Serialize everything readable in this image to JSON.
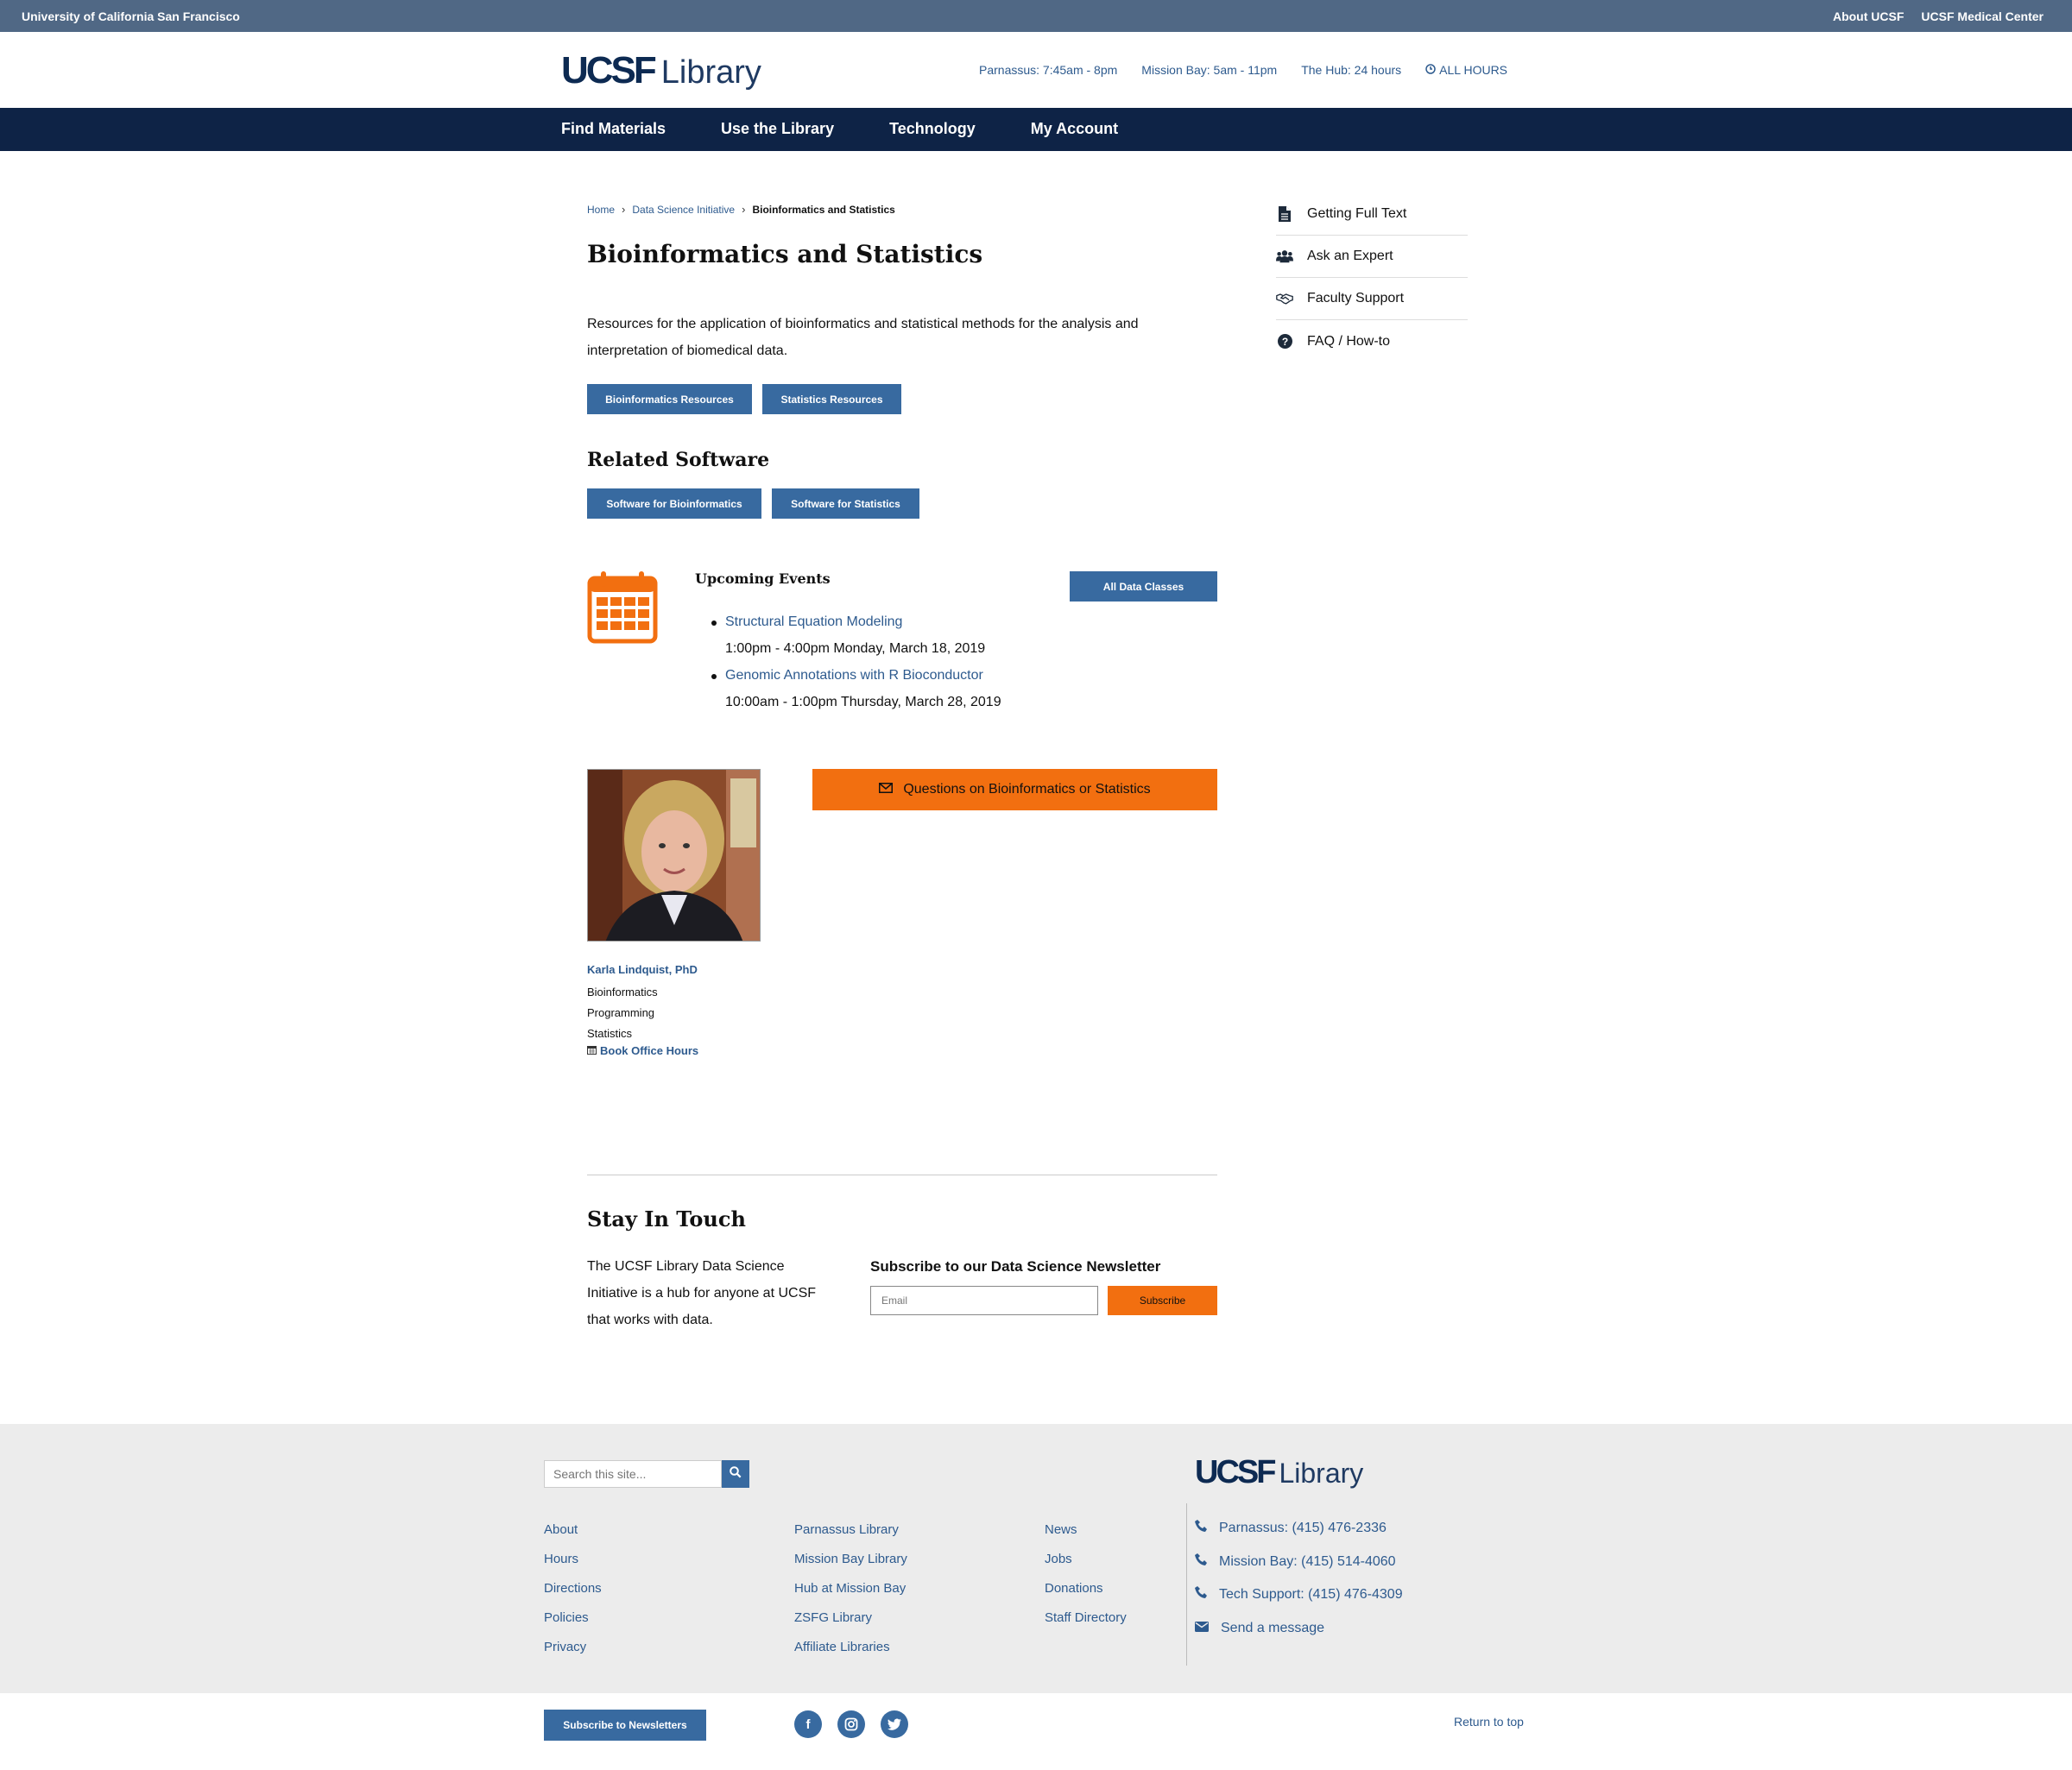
{
  "util": {
    "left": "University of California San Francisco",
    "right": [
      "About UCSF",
      "UCSF Medical Center"
    ]
  },
  "header": {
    "logo_mark": "UCSF",
    "logo_text": "Library",
    "hours": [
      "Parnassus: 7:45am - 8pm",
      "Mission Bay: 5am - 11pm",
      "The Hub: 24 hours"
    ],
    "all_hours": "ALL HOURS"
  },
  "nav": [
    "Find Materials",
    "Use the Library",
    "Technology",
    "My Account"
  ],
  "breadcrumb": {
    "home": "Home",
    "parent": "Data Science Initiative",
    "current": "Bioinformatics and Statistics"
  },
  "main": {
    "title": "Bioinformatics and Statistics",
    "intro": "Resources for the application of bioinformatics and statistical methods for the analysis and interpretation of biomedical data.",
    "buttons": [
      "Bioinformatics Resources",
      "Statistics Resources"
    ],
    "related_title": "Related Software",
    "software_buttons": [
      "Software for Bioinformatics",
      "Software for Statistics"
    ]
  },
  "events": {
    "title": "Upcoming Events",
    "all_button": "All Data Classes",
    "items": [
      {
        "name": "Structural Equation Modeling",
        "when": "1:00pm - 4:00pm Monday, March 18, 2019"
      },
      {
        "name": "Genomic Annotations with R Bioconductor",
        "when": "10:00am - 1:00pm Thursday, March 28, 2019"
      }
    ],
    "icon_color": "#f26f10"
  },
  "person": {
    "name": "Karla Lindquist, PhD",
    "topics": [
      "Bioinformatics",
      "Programming",
      "Statistics"
    ],
    "book": "Book Office Hours"
  },
  "question_button": "Questions on Bioinformatics or Statistics",
  "stay": {
    "title": "Stay In Touch",
    "text": "The UCSF Library Data Science Initiative is a hub for anyone at UCSF that works with data.",
    "subscribe_title": "Subscribe to our Data Science Newsletter",
    "email_placeholder": "Email",
    "subscribe_button": "Subscribe"
  },
  "sidebar": [
    {
      "label": "Getting Full Text",
      "icon": "document-icon"
    },
    {
      "label": "Ask an Expert",
      "icon": "people-icon"
    },
    {
      "label": "Faculty Support",
      "icon": "handshake-icon"
    },
    {
      "label": "FAQ / How-to",
      "icon": "question-icon"
    }
  ],
  "footer": {
    "search_placeholder": "Search this site...",
    "col1": [
      "About",
      "Hours",
      "Directions",
      "Policies",
      "Privacy"
    ],
    "col2": [
      "Parnassus Library",
      "Mission Bay Library",
      "Hub at Mission Bay",
      "ZSFG Library",
      "Affiliate Libraries"
    ],
    "col3": [
      "News",
      "Jobs",
      "Donations",
      "Staff Directory"
    ],
    "logo_mark": "UCSF",
    "logo_text": "Library",
    "contacts": [
      "Parnassus: (415) 476-2336",
      "Mission Bay: (415) 514-4060",
      "Tech Support: (415) 476-4309",
      "Send a message"
    ],
    "newsletter_button": "Subscribe to Newsletters",
    "social": [
      "f",
      "ig",
      "tw"
    ],
    "return_top": "Return to top"
  },
  "colors": {
    "accent": "#386aa0",
    "nav": "#0e2346",
    "orange": "#f26f10",
    "util": "#506885"
  }
}
